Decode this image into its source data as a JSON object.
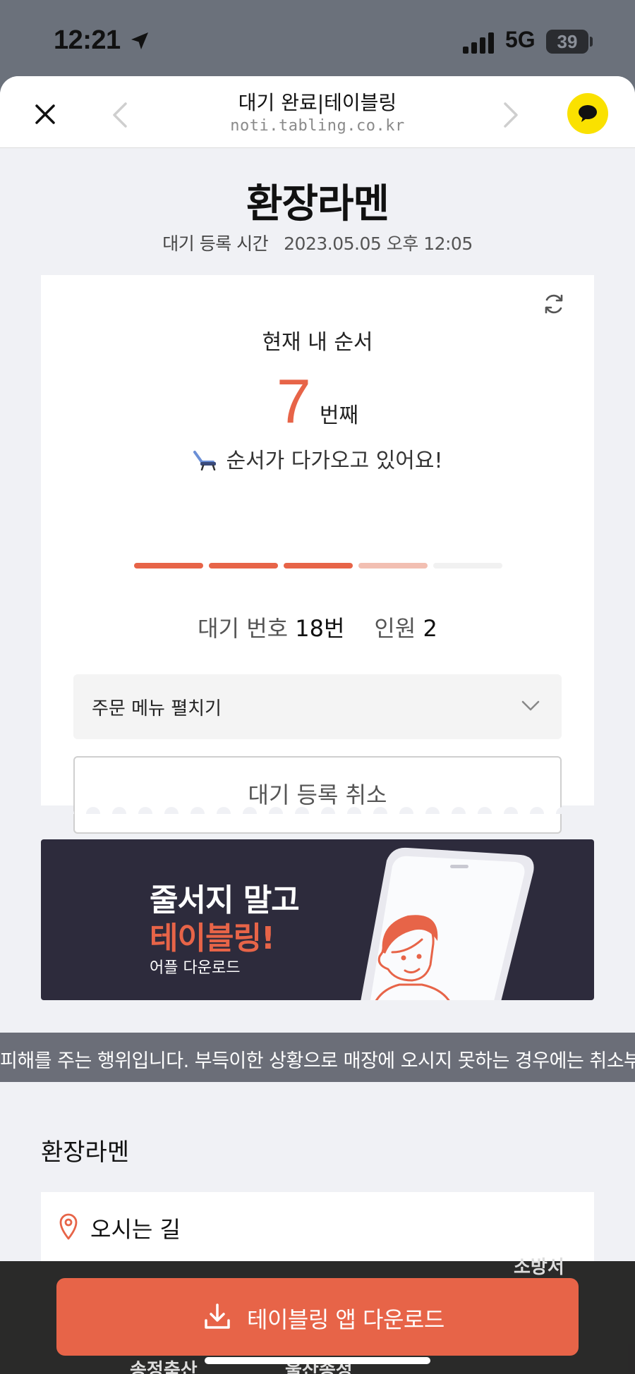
{
  "status_bar": {
    "time": "12:21",
    "network": "5G",
    "battery": "39"
  },
  "browser": {
    "title": "대기 완료|테이블링",
    "url": "noti.tabling.co.kr"
  },
  "store": {
    "name": "환장라멘",
    "registered_label": "대기 등록 시간",
    "registered_value": "2023.05.05 오후 12:05"
  },
  "queue": {
    "label": "현재 내 순서",
    "position": "7",
    "position_unit": "번째",
    "message": "순서가 다가오고 있어요!",
    "progress_steps": 5,
    "progress_filled": 3,
    "progress_current": 4,
    "wait_number_label": "대기 번호",
    "wait_number_value": "18번",
    "party_label": "인원",
    "party_value": "2",
    "order_toggle_label": "주문 메뉴 펼치기",
    "cancel_label": "대기 등록 취소"
  },
  "banner": {
    "line1": "줄서지 말고",
    "line2": "테이블링!",
    "line3": "어플 다운로드"
  },
  "notice": {
    "text": "피해를 주는 행위입니다. 부득이한 상황으로 매장에 오시지 못하는 경우에는 취소부탁드립니"
  },
  "location": {
    "section_title": "환장라멘",
    "directions_label": "오시는 길",
    "map_labels": [
      "소방서",
      "송정축산",
      "울산송정"
    ]
  },
  "footer": {
    "download_label": "테이블링 앱 다운로드"
  },
  "colors": {
    "accent": "#e76448",
    "accent_light": "#f2bfb2",
    "kakao_yellow": "#fae100",
    "banner_bg": "#2d2b3c",
    "sheet_bg": "#f0f1f5"
  },
  "icons": [
    "location-arrow-icon",
    "signal-icon",
    "battery-icon",
    "close-icon",
    "chevron-left-icon",
    "chevron-right-icon",
    "kakao-chat-icon",
    "refresh-icon",
    "chair-icon",
    "chevron-down-icon",
    "map-pin-icon",
    "download-icon"
  ]
}
